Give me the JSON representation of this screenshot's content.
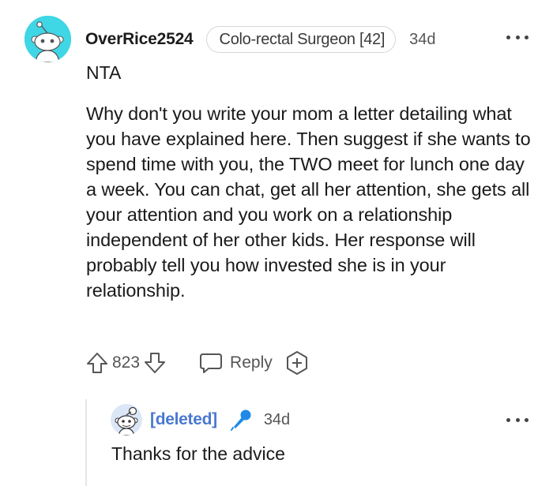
{
  "comment": {
    "username": "OverRice2524",
    "flair": "Colo-rectal Surgeon [42]",
    "timestamp": "34d",
    "verdict": "NTA",
    "body": "Why don't you write your mom a letter detailing what you have explained here. Then suggest if she wants to spend time with you, the TWO meet for lunch one day a week. You can chat, get all her attention, she gets all your attention and you work on a relationship independent of her other kids. Her response will probably tell you how invested she is in your relationship.",
    "vote_count": "823",
    "reply_label": "Reply",
    "avatar_color": "#3fd6e6"
  },
  "reply": {
    "username": "[deleted]",
    "timestamp": "34d",
    "body": "Thanks for the advice",
    "username_color": "#4a78d0",
    "mic_color": "#1e8ae6"
  },
  "icons": {
    "more": "more-horizontal-icon",
    "upvote": "upvote-arrow-icon",
    "downvote": "downvote-arrow-icon",
    "reply": "speech-bubble-icon",
    "award": "award-plus-icon",
    "mic": "microphone-icon"
  }
}
